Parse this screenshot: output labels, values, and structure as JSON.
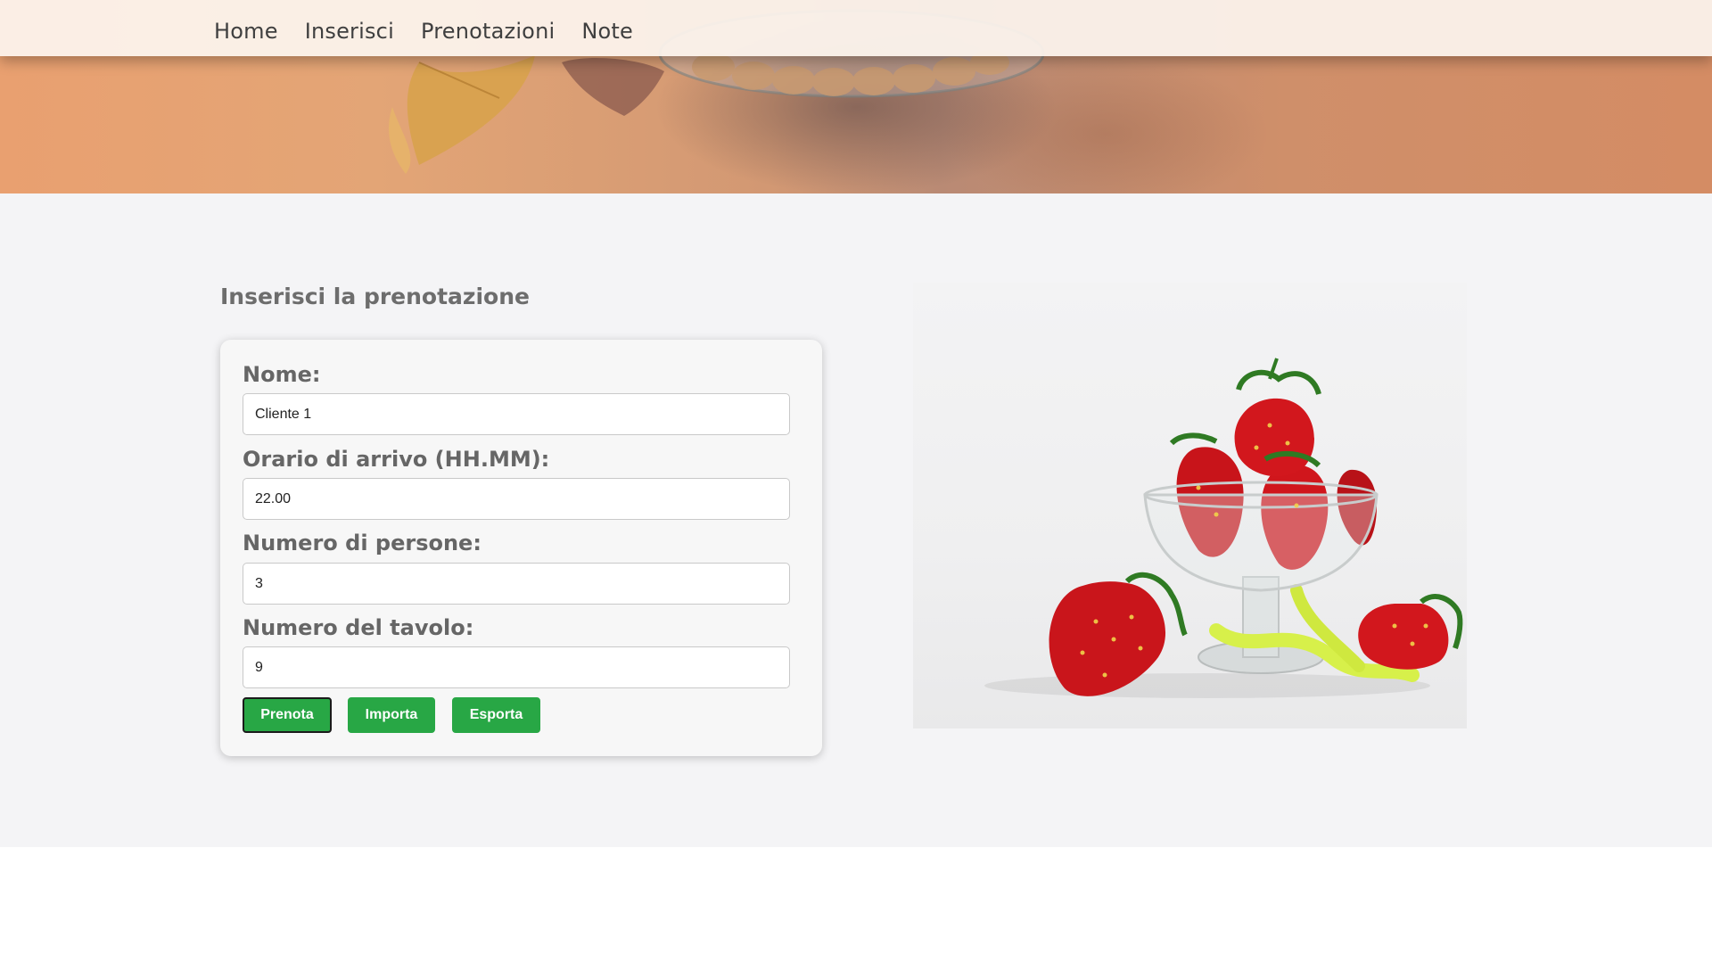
{
  "nav": {
    "items": [
      "Home",
      "Inserisci",
      "Prenotazioni",
      "Note"
    ]
  },
  "form": {
    "title": "Inserisci la prenotazione",
    "name_label": "Nome:",
    "name_value": "Cliente 1",
    "arrival_label": "Orario di arrivo (HH.MM):",
    "arrival_value": "22.00",
    "people_label": "Numero di persone:",
    "people_value": "3",
    "table_label": "Numero del tavolo:",
    "table_value": "9",
    "buttons": {
      "book": "Prenota",
      "import": "Importa",
      "export": "Esporta"
    }
  },
  "colors": {
    "button_green": "#28a745",
    "page_background": "#f4f4f6",
    "text_gray": "#666666"
  },
  "icons": {
    "hero": "dessert-banner-image",
    "photo": "strawberries-in-glass-image"
  }
}
